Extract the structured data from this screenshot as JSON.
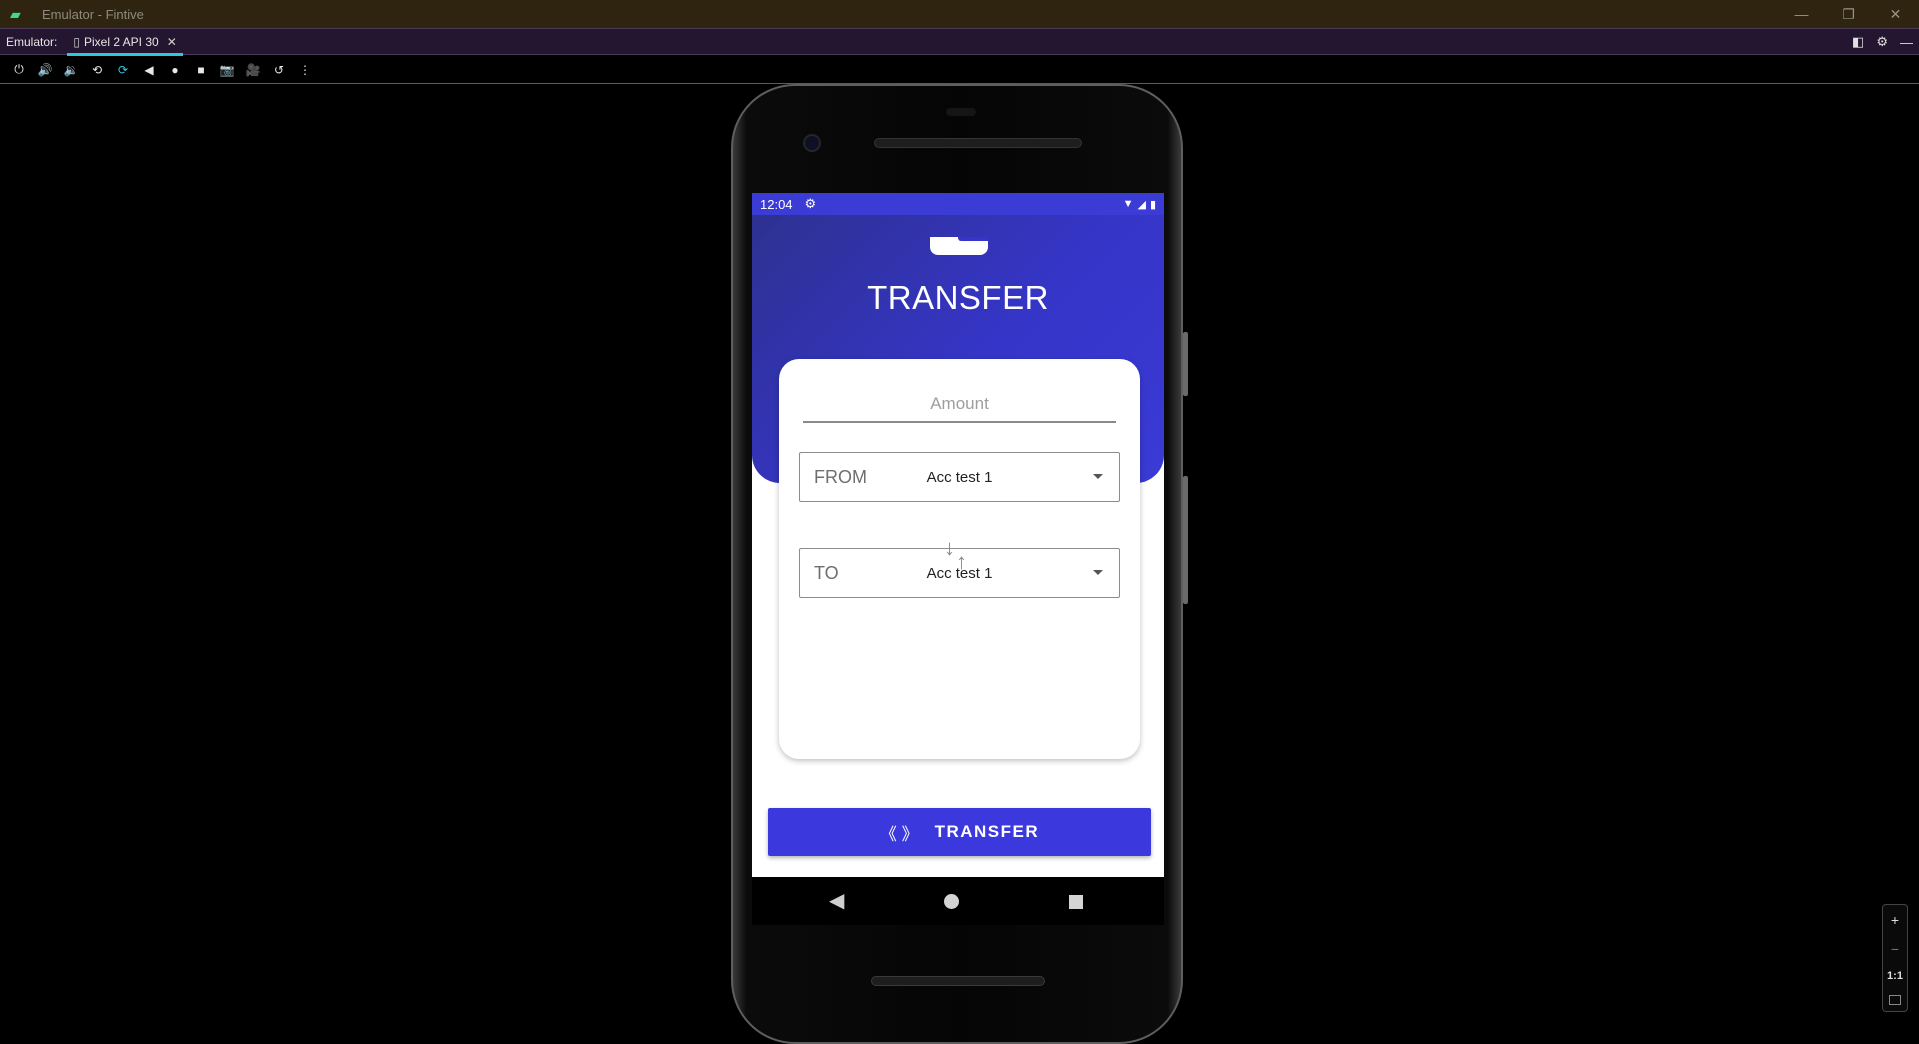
{
  "window": {
    "title": "Emulator - Fintive",
    "icon": "android-icon",
    "controls": [
      "minimize",
      "restore",
      "close"
    ]
  },
  "tabbar": {
    "label": "Emulator:",
    "tab_label": "Pixel 2 API 30",
    "tab_close": "✕"
  },
  "toolbar": {
    "items": [
      "power",
      "volume-up",
      "volume-down",
      "rotate-left",
      "rotate-right",
      "back",
      "home",
      "overview",
      "screenshot",
      "record",
      "snapshot",
      "more"
    ]
  },
  "device": {
    "statusbar": {
      "time": "12:04"
    },
    "screen_title": "TRANSFER",
    "amount": {
      "placeholder": "Amount",
      "value": ""
    },
    "from": {
      "label": "FROM",
      "selected": "Acc test 1"
    },
    "to": {
      "label": "TO",
      "selected": "Acc test 1"
    },
    "transfer_button": {
      "icon": "《 》",
      "label": "TRANSFER"
    },
    "colors": {
      "primary": "#3B39DD",
      "header_dark": "#2E3190",
      "header_light": "#3A3AD6"
    }
  },
  "zoom": {
    "plus": "+",
    "minus": "−",
    "one_to_one": "1:1"
  }
}
